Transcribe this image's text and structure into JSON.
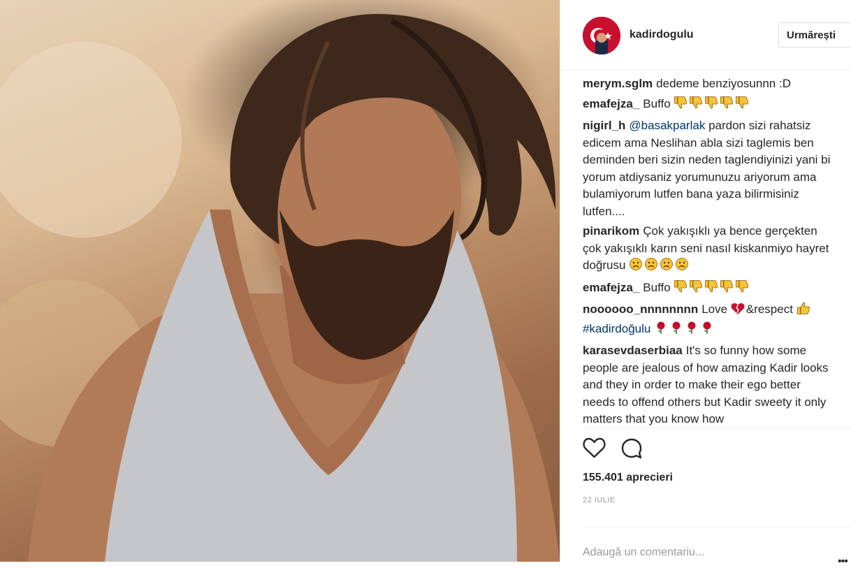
{
  "post": {
    "username": "kadirdogulu",
    "follow_label": "Urmărești",
    "likes_text": "155.401 aprecieri",
    "date_text": "22 IULIE",
    "comment_placeholder": "Adaugă un comentariu..."
  },
  "comments": [
    {
      "user": "merym.sglm",
      "text": "dedeme benziyosunnn :D"
    },
    {
      "user": "emafejza_",
      "text": "Buffo",
      "emoji": "thumbs-down-icon",
      "emoji_count": 5
    },
    {
      "user": "nigirl_h",
      "mention": "@basakparlak",
      "text": "pardon sizi rahatsiz edicem ama Neslihan abla sizi taglemis ben deminden beri sizin neden taglendiyinizi yani bi yorum atdiysaniz yorumunuzu ariyorum ama bulamiyorum lutfen bana yaza bilirmisiniz lutfen...."
    },
    {
      "user": "pinarikom",
      "text": "Çok yakışıklı ya bence gerçekten çok yakışıklı karın seni nasıl kiskanmiyo hayret doğrusu",
      "emoji": "frowning-face-icon",
      "emoji_count": 4
    },
    {
      "user": "emafejza_",
      "text": "Buffo",
      "emoji": "thumbs-down-icon",
      "emoji_count": 5
    },
    {
      "user": "noooooo_nnnnnnnn",
      "text": "Love",
      "text2": "&respect",
      "hashtag": "#kadirdoğulu"
    },
    {
      "user": "karasevdaserbiaa",
      "text": "It's so funny how some people are jealous of how amazing Kadir looks and they in order to make their ego better needs to offend others but Kadir sweety it only matters that you know how"
    }
  ],
  "colors": {
    "mention": "#003569",
    "border": "#efefef",
    "muted": "#999999"
  }
}
